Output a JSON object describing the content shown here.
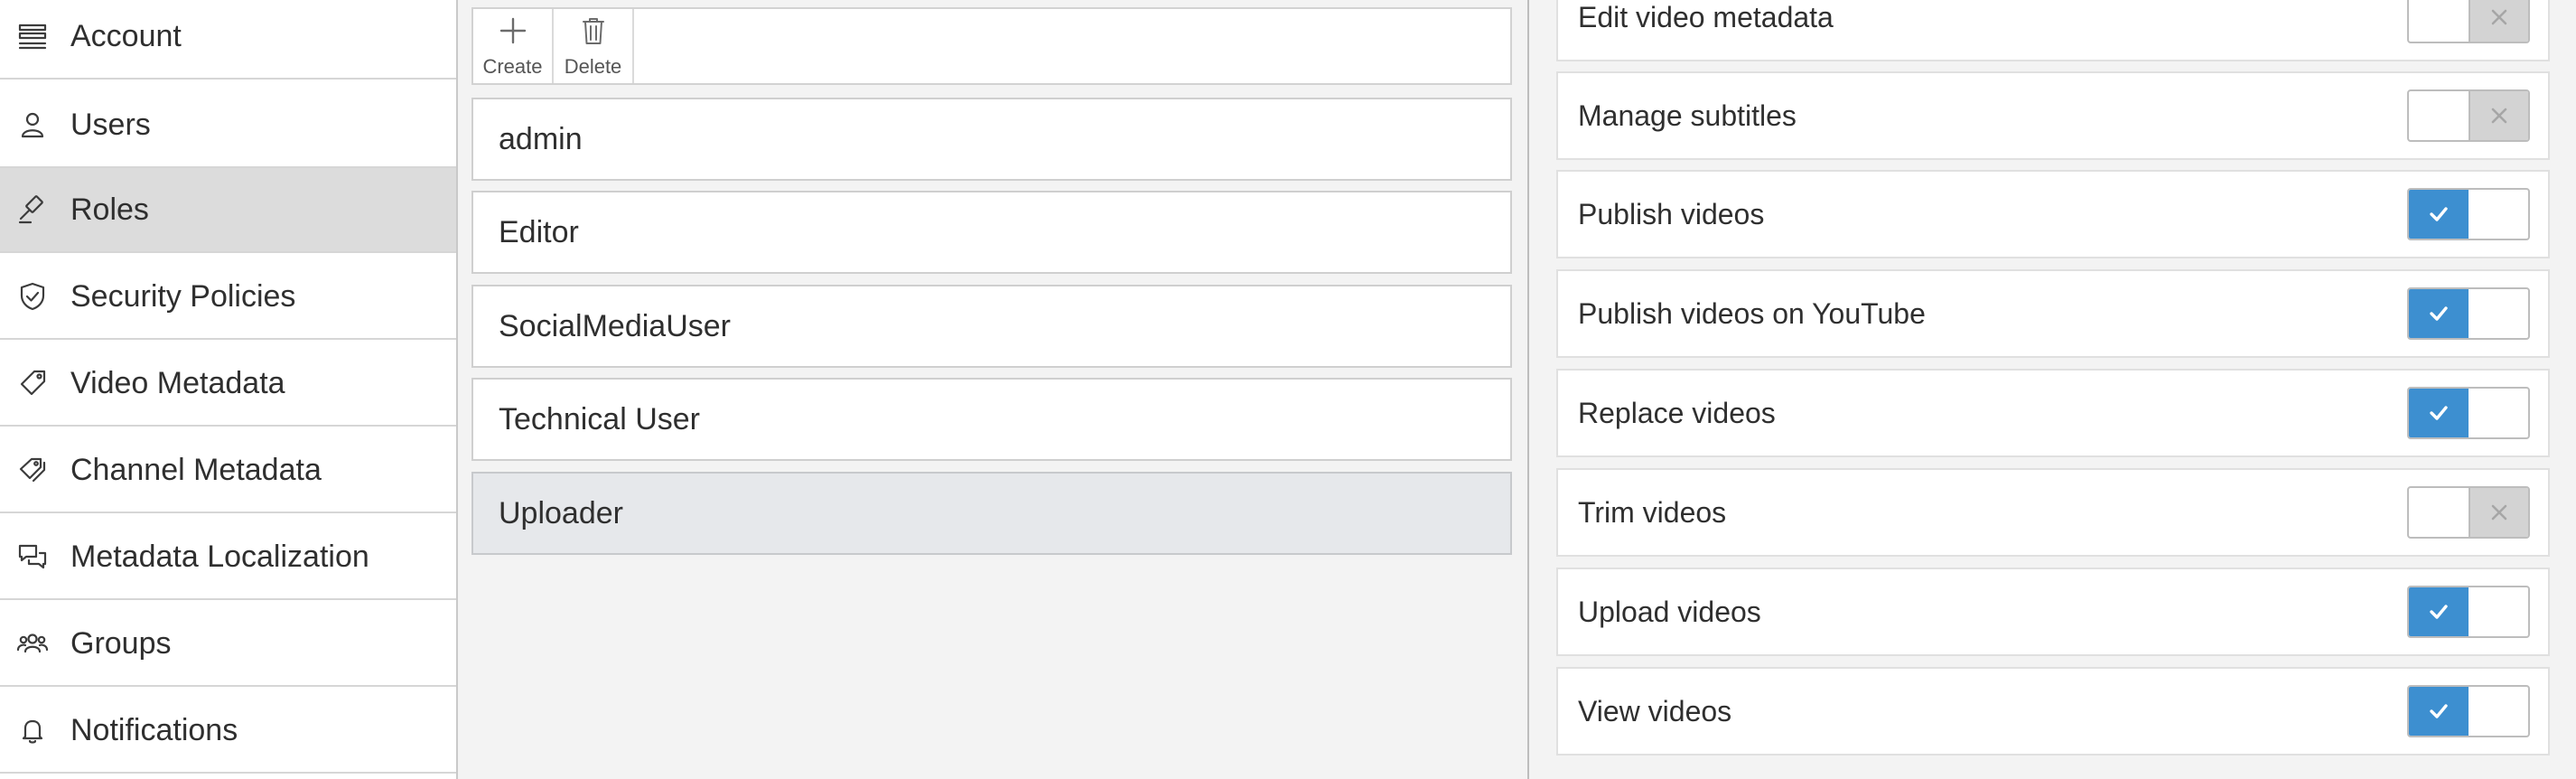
{
  "nav": {
    "items": [
      {
        "label": "Account",
        "icon": "account-list-icon",
        "active": false
      },
      {
        "label": "Users",
        "icon": "user-icon",
        "active": false
      },
      {
        "label": "Roles",
        "icon": "gavel-icon",
        "active": true
      },
      {
        "label": "Security Policies",
        "icon": "shield-check-icon",
        "active": false
      },
      {
        "label": "Video Metadata",
        "icon": "tag-icon",
        "active": false
      },
      {
        "label": "Channel Metadata",
        "icon": "tags-icon",
        "active": false
      },
      {
        "label": "Metadata Localization",
        "icon": "chat-bubbles-icon",
        "active": false
      },
      {
        "label": "Groups",
        "icon": "group-icon",
        "active": false
      },
      {
        "label": "Notifications",
        "icon": "bell-icon",
        "active": false
      }
    ]
  },
  "toolbar": {
    "create_label": "Create",
    "delete_label": "Delete"
  },
  "roles": {
    "items": [
      {
        "label": "admin",
        "selected": false
      },
      {
        "label": "Editor",
        "selected": false
      },
      {
        "label": "SocialMediaUser",
        "selected": false
      },
      {
        "label": "Technical User",
        "selected": false
      },
      {
        "label": "Uploader",
        "selected": true
      }
    ]
  },
  "permissions": {
    "items": [
      {
        "label": "Edit video metadata",
        "enabled": false
      },
      {
        "label": "Manage subtitles",
        "enabled": false
      },
      {
        "label": "Publish videos",
        "enabled": true
      },
      {
        "label": "Publish videos on YouTube",
        "enabled": true
      },
      {
        "label": "Replace videos",
        "enabled": true
      },
      {
        "label": "Trim videos",
        "enabled": false
      },
      {
        "label": "Upload videos",
        "enabled": true
      },
      {
        "label": "View videos",
        "enabled": true
      }
    ]
  },
  "colors": {
    "accent": "#3d8fd0",
    "nav_active": "#dcdcdc",
    "role_selected": "#e6e8eb"
  }
}
